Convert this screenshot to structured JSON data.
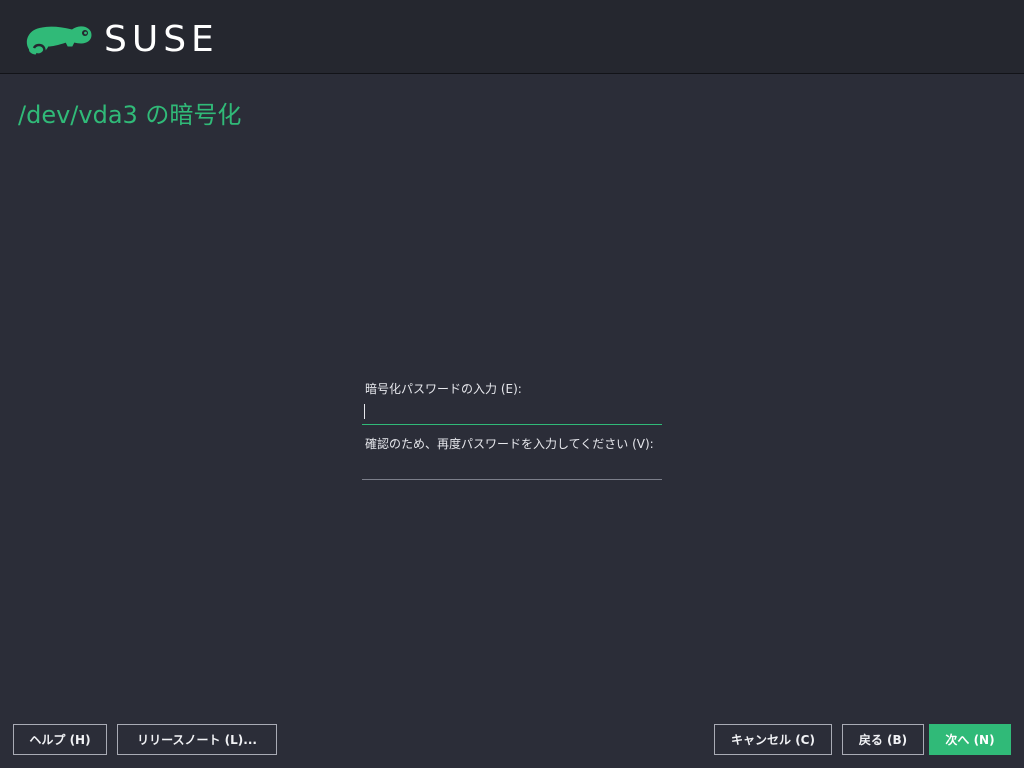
{
  "header": {
    "logo_text": "SUSE",
    "logo_icon": "chameleon-icon"
  },
  "page": {
    "title": "/dev/vda3 の暗号化"
  },
  "form": {
    "password_label": "暗号化パスワードの入力 (E):",
    "password_value": "",
    "verify_label": "確認のため、再度パスワードを入力してください (V):",
    "verify_value": ""
  },
  "buttons": {
    "help": "ヘルプ (H)",
    "release_notes": "リリースノート (L)...",
    "cancel": "キャンセル (C)",
    "back": "戻る (B)",
    "next": "次へ (N)"
  },
  "colors": {
    "accent": "#30ba78",
    "background": "#2b2d38",
    "header": "#25272f"
  }
}
